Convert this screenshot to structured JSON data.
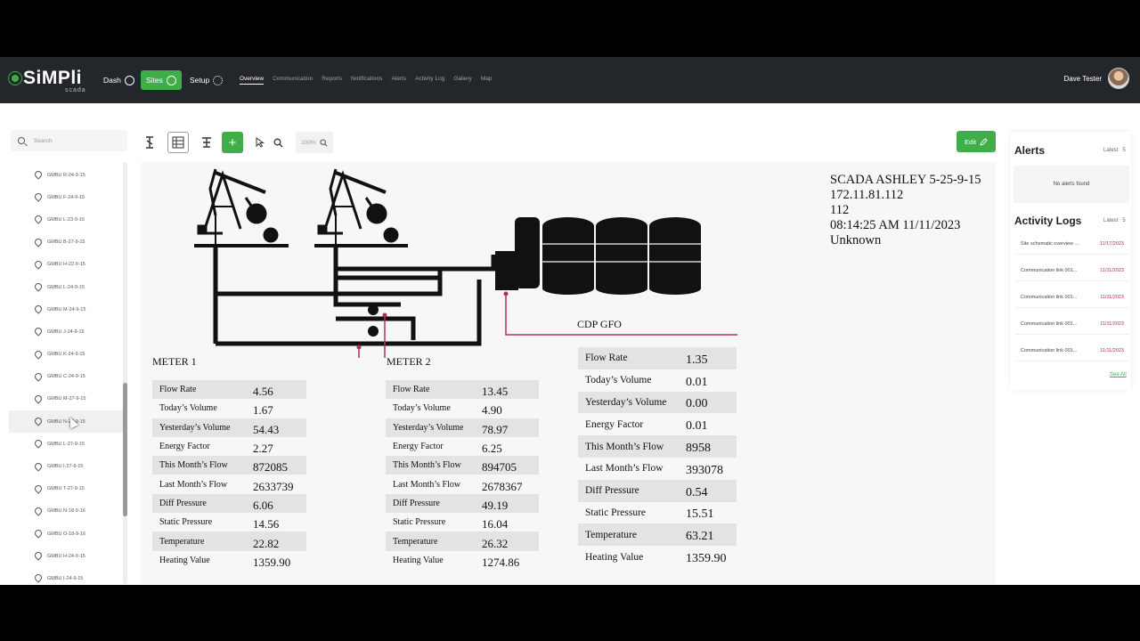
{
  "app": {
    "brand": "SiMPli",
    "brand_sub": "scada"
  },
  "nav": {
    "dash": "Dash",
    "sites": "Sites",
    "setup": "Setup"
  },
  "tabs": [
    "Overview",
    "Communication",
    "Reports",
    "Notifications",
    "Alerts",
    "Activity Log",
    "Gallery",
    "Map"
  ],
  "user": {
    "name": "Dave Tester"
  },
  "search": {
    "placeholder": "Search"
  },
  "sites": [
    "GMBU R-24-9-15",
    "GMBU F-24-9-15",
    "GMBU L-23-9-15",
    "GMBU B-27-9-15",
    "GMBU H-22-9-15",
    "GMBU L-24-9-15",
    "GMBU M-24-9-15",
    "GMBU J-24-9-15",
    "GMBU K-24-9-15",
    "GMBU C-24-9-15",
    "GMBU M-27-9-15",
    "GMBU N-27-9-15",
    "GMBU L-27-9-15",
    "GMBU I-27-9-15",
    "GMBU T-27-9-15",
    "GMBU N-18-9-16",
    "GMBU O-18-9-16",
    "GMBU H-24-9-15",
    "GMBU I-24-9-15"
  ],
  "toolbar": {
    "zoom": "100%",
    "edit": "Edit"
  },
  "site_info": {
    "name": "SCADA ASHLEY 5-25-9-15",
    "ip": "172.11.81.112",
    "id": "112",
    "timestamp": "08:14:25 AM 11/11/2023",
    "status": "Unknown"
  },
  "meter1": {
    "title": "METER 1",
    "rows": [
      {
        "k": "Flow Rate",
        "v": "4.56"
      },
      {
        "k": "Today’s Volume",
        "v": "1.67"
      },
      {
        "k": "Yesterday’s Volume",
        "v": "54.43"
      },
      {
        "k": "Energy Factor",
        "v": "2.27"
      },
      {
        "k": "This Month’s Flow",
        "v": "872085"
      },
      {
        "k": "Last Month’s Flow",
        "v": "2633739"
      },
      {
        "k": "Diff Pressure",
        "v": "6.06"
      },
      {
        "k": "Static Pressure",
        "v": "14.56"
      },
      {
        "k": "Temperature",
        "v": "22.82"
      },
      {
        "k": "Heating Value",
        "v": "1359.90"
      }
    ]
  },
  "meter2": {
    "title": "METER 2",
    "rows": [
      {
        "k": "Flow Rate",
        "v": "13.45"
      },
      {
        "k": "Today’s Volume",
        "v": "4.90"
      },
      {
        "k": "Yesterday’s Volume",
        "v": "78.97"
      },
      {
        "k": "Energy Factor",
        "v": "6.25"
      },
      {
        "k": "This Month’s Flow",
        "v": "894705"
      },
      {
        "k": "Last Month’s Flow",
        "v": "2678367"
      },
      {
        "k": "Diff Pressure",
        "v": "49.19"
      },
      {
        "k": "Static Pressure",
        "v": "16.04"
      },
      {
        "k": "Temperature",
        "v": "26.32"
      },
      {
        "k": "Heating Value",
        "v": "1274.86"
      }
    ]
  },
  "cdp": {
    "title": "CDP GFO",
    "rows": [
      {
        "k": "Flow Rate",
        "v": "1.35"
      },
      {
        "k": "Today’s Volume",
        "v": "0.01"
      },
      {
        "k": "Yesterday’s Volume",
        "v": "0.00"
      },
      {
        "k": "Energy Factor",
        "v": "0.01"
      },
      {
        "k": "This Month’s Flow",
        "v": "8958"
      },
      {
        "k": "Last Month’s Flow",
        "v": "393078"
      },
      {
        "k": "Diff Pressure",
        "v": "0.54"
      },
      {
        "k": "Static Pressure",
        "v": "15.51"
      },
      {
        "k": "Temperature",
        "v": "63.21"
      },
      {
        "k": "Heating Value",
        "v": "1359.90"
      }
    ]
  },
  "alerts": {
    "title": "Alerts",
    "latest": "Latest",
    "count": "5",
    "empty": "No alerts found"
  },
  "activity": {
    "title": "Activity Logs",
    "latest": "Latest",
    "count": "5",
    "see_all": "See All",
    "items": [
      {
        "text": "Site schematic overview ...",
        "date": "11/17/2023"
      },
      {
        "text": "Communication link 001...",
        "date": "11/11/2023"
      },
      {
        "text": "Communication link 001...",
        "date": "11/11/2023"
      },
      {
        "text": "Communication link 001...",
        "date": "11/11/2023"
      },
      {
        "text": "Communication link 001...",
        "date": "11/11/2023"
      }
    ]
  },
  "colors": {
    "brand_green": "#3fae49",
    "header_bg": "#23262b",
    "pipe_red": "#b1324b"
  }
}
